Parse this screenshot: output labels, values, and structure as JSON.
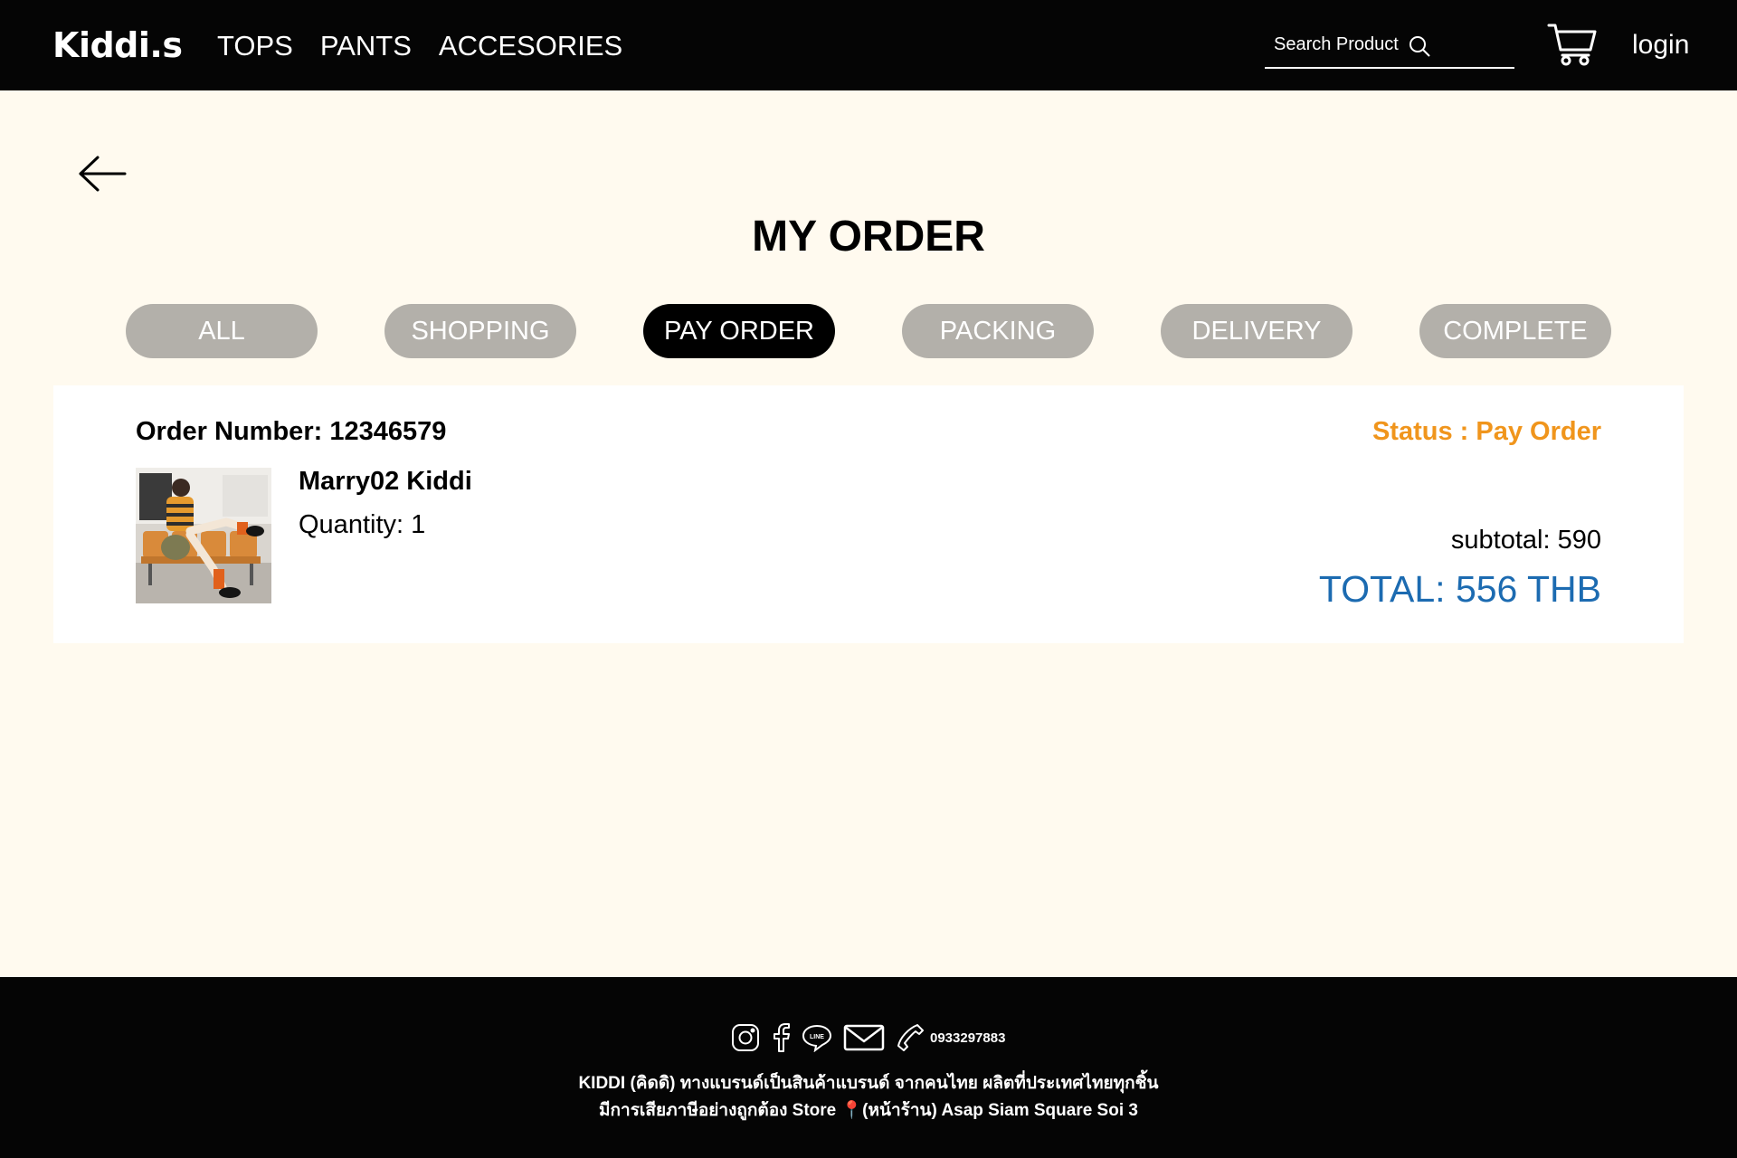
{
  "header": {
    "logo": "Kiddi.s",
    "nav": [
      "TOPS",
      "PANTS",
      "ACCESORIES"
    ],
    "search_placeholder": "Search Product",
    "login": "login"
  },
  "page": {
    "title": "MY ORDER",
    "tabs": [
      "ALL",
      "SHOPPING",
      "PAY ORDER",
      "PACKING",
      "DELIVERY",
      "COMPLETE"
    ],
    "active_tab": "PAY ORDER"
  },
  "order": {
    "number_label": "Order Number: 12346579",
    "status_label": "Status : Pay Order",
    "product_name": "Marry02 Kiddi",
    "quantity_label": "Quantity: 1",
    "subtotal_label": "subtotal: 590",
    "total_label": "TOTAL: 556 THB"
  },
  "footer": {
    "phone": "0933297883",
    "line1": "KIDDI (คิดดิ) ทางแบรนด์เป็นสินค้าแบรนด์ จากคนไทย ผลิตที่ประเทศไทยทุกชิ้น",
    "line2": "มีการเสียภาษีอย่างถูกต้อง Store 📍(หน้าร้าน) Asap Siam Square Soi 3"
  },
  "colors": {
    "header_bg": "#050505",
    "page_bg": "#fffaef",
    "status": "#f0951c",
    "total": "#1c6bb1",
    "tab_inactive": "#b3b0aa",
    "tab_active": "#000000"
  },
  "icons": [
    "search-icon",
    "cart-icon",
    "back-arrow-icon",
    "instagram-icon",
    "facebook-icon",
    "line-icon",
    "mail-icon",
    "phone-icon"
  ]
}
